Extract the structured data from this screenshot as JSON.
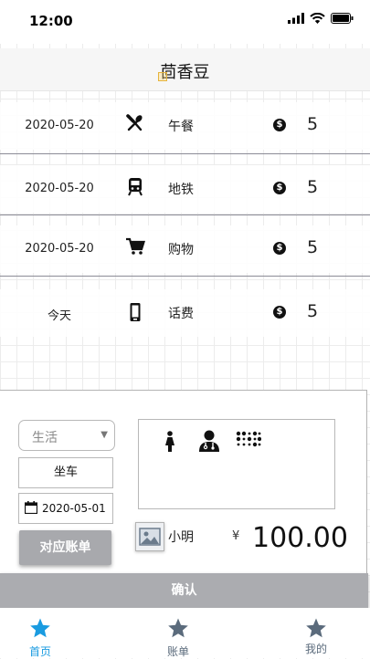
{
  "status_bar": {
    "time": "12:00"
  },
  "header": {
    "title": "茴香豆"
  },
  "records": [
    {
      "date": "2020-05-20",
      "category": "午餐",
      "icon": "fork-spoon-icon",
      "currency_symbol": "$",
      "amount": "5"
    },
    {
      "date": "2020-05-20",
      "category": "地铁",
      "icon": "subway-icon",
      "currency_symbol": "$",
      "amount": "5"
    },
    {
      "date": "2020-05-20",
      "category": "购物",
      "icon": "shopping-cart-icon",
      "currency_symbol": "$",
      "amount": "5"
    },
    {
      "date": "今天",
      "category": "话费",
      "icon": "mobile-phone-icon",
      "currency_symbol": "$",
      "amount": "5"
    }
  ],
  "form": {
    "type_select": "生活",
    "note_input": "坐车",
    "date_value": "2020-05-01",
    "account_button": "对应账单",
    "image_icons": [
      "woman-icon",
      "doctor-icon",
      "braille-icon"
    ],
    "user_name": "小明",
    "currency": "¥",
    "total": "100.00"
  },
  "confirm_button": "确认",
  "tabs": [
    {
      "label": "首页",
      "icon": "star-icon",
      "active": true
    },
    {
      "label": "账单",
      "icon": "star-icon",
      "active": false
    },
    {
      "label": "我的",
      "icon": "star-icon",
      "active": false
    }
  ],
  "colors": {
    "accent": "#1a9be0",
    "inactive_tab": "#5b6b7c",
    "button_gray": "#a8a9ad"
  }
}
